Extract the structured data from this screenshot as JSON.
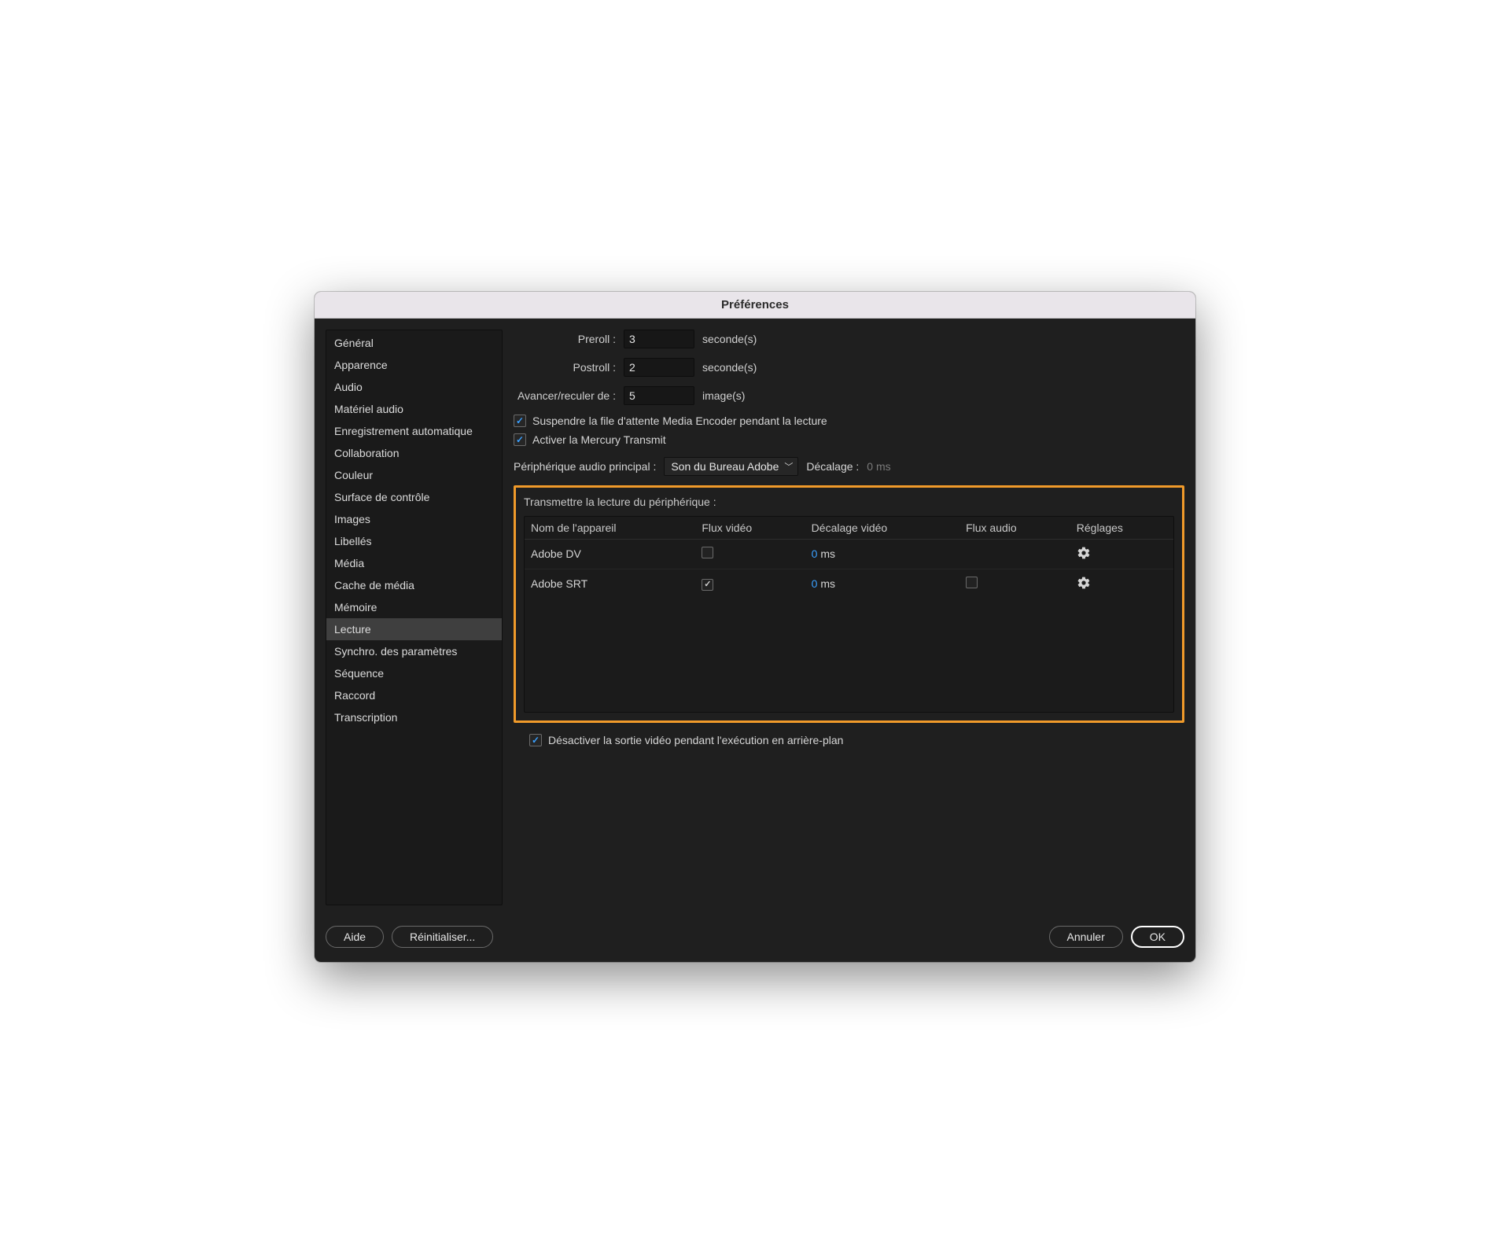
{
  "title": "Préférences",
  "sidebar": {
    "items": [
      {
        "label": "Général",
        "active": false
      },
      {
        "label": "Apparence",
        "active": false
      },
      {
        "label": "Audio",
        "active": false
      },
      {
        "label": "Matériel audio",
        "active": false
      },
      {
        "label": "Enregistrement automatique",
        "active": false
      },
      {
        "label": "Collaboration",
        "active": false
      },
      {
        "label": "Couleur",
        "active": false
      },
      {
        "label": "Surface de contrôle",
        "active": false
      },
      {
        "label": "Images",
        "active": false
      },
      {
        "label": "Libellés",
        "active": false
      },
      {
        "label": "Média",
        "active": false
      },
      {
        "label": "Cache de média",
        "active": false
      },
      {
        "label": "Mémoire",
        "active": false
      },
      {
        "label": "Lecture",
        "active": true
      },
      {
        "label": "Synchro. des paramètres",
        "active": false
      },
      {
        "label": "Séquence",
        "active": false
      },
      {
        "label": "Raccord",
        "active": false
      },
      {
        "label": "Transcription",
        "active": false
      }
    ]
  },
  "form": {
    "preroll": {
      "label": "Preroll :",
      "value": "3",
      "unit": "seconde(s)"
    },
    "postroll": {
      "label": "Postroll :",
      "value": "2",
      "unit": "seconde(s)"
    },
    "step": {
      "label": "Avancer/reculer de :",
      "value": "5",
      "unit": "image(s)"
    }
  },
  "checks": {
    "pause_me": {
      "label": "Suspendre la file d'attente Media Encoder pendant la lecture",
      "checked": true
    },
    "mercury": {
      "label": "Activer la Mercury Transmit",
      "checked": true
    },
    "bg_video": {
      "label": "Désactiver la sortie vidéo pendant l'exécution en arrière-plan",
      "checked": true
    }
  },
  "audio_device": {
    "label": "Périphérique audio principal :",
    "value": "Son du Bureau Adobe",
    "offset_label": "Décalage :",
    "offset_value": "0 ms"
  },
  "transmit": {
    "section_label": "Transmettre la lecture du périphérique :",
    "columns": {
      "name": "Nom de l'appareil",
      "video_flux": "Flux vidéo",
      "video_offset": "Décalage vidéo",
      "audio_flux": "Flux audio",
      "settings": "Réglages"
    },
    "rows": [
      {
        "name": "Adobe DV",
        "video_flux": false,
        "video_offset_num": "0",
        "video_offset_unit": " ms",
        "audio_flux": null,
        "settings": true
      },
      {
        "name": "Adobe SRT",
        "video_flux": true,
        "video_offset_num": "0",
        "video_offset_unit": " ms",
        "audio_flux": false,
        "settings": true
      }
    ]
  },
  "footer": {
    "help": "Aide",
    "reset": "Réinitialiser...",
    "cancel": "Annuler",
    "ok": "OK"
  }
}
